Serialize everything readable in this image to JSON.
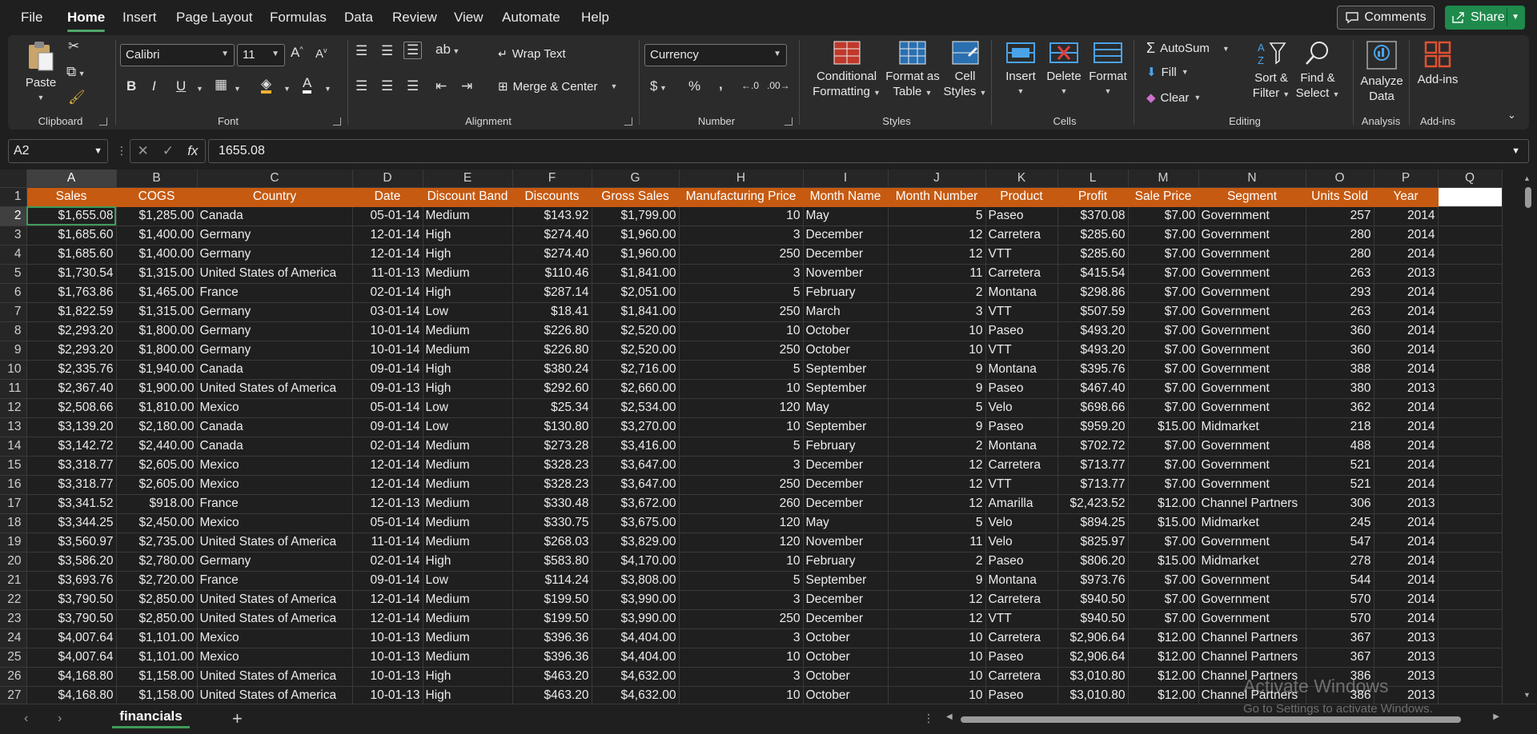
{
  "menu": {
    "items": [
      "File",
      "Home",
      "Insert",
      "Page Layout",
      "Formulas",
      "Data",
      "Review",
      "View",
      "Automate",
      "Help"
    ],
    "active": "Home",
    "comments_label": "Comments",
    "share_label": "Share"
  },
  "ribbon": {
    "clipboard": {
      "label": "Clipboard",
      "paste": "Paste"
    },
    "font": {
      "label": "Font",
      "font_name": "Calibri",
      "font_size": "11"
    },
    "alignment": {
      "label": "Alignment",
      "wrap_text": "Wrap Text",
      "merge_center": "Merge & Center"
    },
    "number": {
      "label": "Number",
      "format": "Currency"
    },
    "styles": {
      "label": "Styles",
      "conditional": [
        "Conditional",
        "Formatting"
      ],
      "format_table": [
        "Format as",
        "Table"
      ],
      "cell_styles": [
        "Cell",
        "Styles"
      ]
    },
    "cells": {
      "label": "Cells",
      "insert": "Insert",
      "delete": "Delete",
      "format": "Format"
    },
    "editing": {
      "label": "Editing",
      "autosum": "AutoSum",
      "fill": "Fill",
      "clear": "Clear",
      "sort": [
        "Sort &",
        "Filter"
      ],
      "find": [
        "Find &",
        "Select"
      ]
    },
    "analysis": {
      "label": "Analysis",
      "analyze": [
        "Analyze",
        "Data"
      ]
    },
    "addins": {
      "label": "Add-ins",
      "addins": "Add-ins"
    }
  },
  "formula_bar": {
    "cell_ref": "A2",
    "formula": "1655.08",
    "fx": "fx"
  },
  "sheet": {
    "columns": [
      "A",
      "B",
      "C",
      "D",
      "E",
      "F",
      "G",
      "H",
      "I",
      "J",
      "K",
      "L",
      "M",
      "N",
      "O",
      "P",
      "Q"
    ],
    "headers": [
      "Sales",
      "COGS",
      "Country",
      "Date",
      "Discount Band",
      "Discounts",
      "Gross Sales",
      "Manufacturing Price",
      "Month Name",
      "Month Number",
      "Product",
      "Profit",
      "Sale Price",
      "Segment",
      "Units Sold",
      "Year"
    ],
    "rows": [
      [
        "$1,655.08",
        "$1,285.00",
        "Canada",
        "05-01-14",
        "Medium",
        "$143.92",
        "$1,799.00",
        "10",
        "May",
        "5",
        "Paseo",
        "$370.08",
        "$7.00",
        "Government",
        "257",
        "2014"
      ],
      [
        "$1,685.60",
        "$1,400.00",
        "Germany",
        "12-01-14",
        "High",
        "$274.40",
        "$1,960.00",
        "3",
        "December",
        "12",
        "Carretera",
        "$285.60",
        "$7.00",
        "Government",
        "280",
        "2014"
      ],
      [
        "$1,685.60",
        "$1,400.00",
        "Germany",
        "12-01-14",
        "High",
        "$274.40",
        "$1,960.00",
        "250",
        "December",
        "12",
        "VTT",
        "$285.60",
        "$7.00",
        "Government",
        "280",
        "2014"
      ],
      [
        "$1,730.54",
        "$1,315.00",
        "United States of America",
        "11-01-13",
        "Medium",
        "$110.46",
        "$1,841.00",
        "3",
        "November",
        "11",
        "Carretera",
        "$415.54",
        "$7.00",
        "Government",
        "263",
        "2013"
      ],
      [
        "$1,763.86",
        "$1,465.00",
        "France",
        "02-01-14",
        "High",
        "$287.14",
        "$2,051.00",
        "5",
        "February",
        "2",
        "Montana",
        "$298.86",
        "$7.00",
        "Government",
        "293",
        "2014"
      ],
      [
        "$1,822.59",
        "$1,315.00",
        "Germany",
        "03-01-14",
        "Low",
        "$18.41",
        "$1,841.00",
        "250",
        "March",
        "3",
        "VTT",
        "$507.59",
        "$7.00",
        "Government",
        "263",
        "2014"
      ],
      [
        "$2,293.20",
        "$1,800.00",
        "Germany",
        "10-01-14",
        "Medium",
        "$226.80",
        "$2,520.00",
        "10",
        "October",
        "10",
        "Paseo",
        "$493.20",
        "$7.00",
        "Government",
        "360",
        "2014"
      ],
      [
        "$2,293.20",
        "$1,800.00",
        "Germany",
        "10-01-14",
        "Medium",
        "$226.80",
        "$2,520.00",
        "250",
        "October",
        "10",
        "VTT",
        "$493.20",
        "$7.00",
        "Government",
        "360",
        "2014"
      ],
      [
        "$2,335.76",
        "$1,940.00",
        "Canada",
        "09-01-14",
        "High",
        "$380.24",
        "$2,716.00",
        "5",
        "September",
        "9",
        "Montana",
        "$395.76",
        "$7.00",
        "Government",
        "388",
        "2014"
      ],
      [
        "$2,367.40",
        "$1,900.00",
        "United States of America",
        "09-01-13",
        "High",
        "$292.60",
        "$2,660.00",
        "10",
        "September",
        "9",
        "Paseo",
        "$467.40",
        "$7.00",
        "Government",
        "380",
        "2013"
      ],
      [
        "$2,508.66",
        "$1,810.00",
        "Mexico",
        "05-01-14",
        "Low",
        "$25.34",
        "$2,534.00",
        "120",
        "May",
        "5",
        "Velo",
        "$698.66",
        "$7.00",
        "Government",
        "362",
        "2014"
      ],
      [
        "$3,139.20",
        "$2,180.00",
        "Canada",
        "09-01-14",
        "Low",
        "$130.80",
        "$3,270.00",
        "10",
        "September",
        "9",
        "Paseo",
        "$959.20",
        "$15.00",
        "Midmarket",
        "218",
        "2014"
      ],
      [
        "$3,142.72",
        "$2,440.00",
        "Canada",
        "02-01-14",
        "Medium",
        "$273.28",
        "$3,416.00",
        "5",
        "February",
        "2",
        "Montana",
        "$702.72",
        "$7.00",
        "Government",
        "488",
        "2014"
      ],
      [
        "$3,318.77",
        "$2,605.00",
        "Mexico",
        "12-01-14",
        "Medium",
        "$328.23",
        "$3,647.00",
        "3",
        "December",
        "12",
        "Carretera",
        "$713.77",
        "$7.00",
        "Government",
        "521",
        "2014"
      ],
      [
        "$3,318.77",
        "$2,605.00",
        "Mexico",
        "12-01-14",
        "Medium",
        "$328.23",
        "$3,647.00",
        "250",
        "December",
        "12",
        "VTT",
        "$713.77",
        "$7.00",
        "Government",
        "521",
        "2014"
      ],
      [
        "$3,341.52",
        "$918.00",
        "France",
        "12-01-13",
        "Medium",
        "$330.48",
        "$3,672.00",
        "260",
        "December",
        "12",
        "Amarilla",
        "$2,423.52",
        "$12.00",
        "Channel Partners",
        "306",
        "2013"
      ],
      [
        "$3,344.25",
        "$2,450.00",
        "Mexico",
        "05-01-14",
        "Medium",
        "$330.75",
        "$3,675.00",
        "120",
        "May",
        "5",
        "Velo",
        "$894.25",
        "$15.00",
        "Midmarket",
        "245",
        "2014"
      ],
      [
        "$3,560.97",
        "$2,735.00",
        "United States of America",
        "11-01-14",
        "Medium",
        "$268.03",
        "$3,829.00",
        "120",
        "November",
        "11",
        "Velo",
        "$825.97",
        "$7.00",
        "Government",
        "547",
        "2014"
      ],
      [
        "$3,586.20",
        "$2,780.00",
        "Germany",
        "02-01-14",
        "High",
        "$583.80",
        "$4,170.00",
        "10",
        "February",
        "2",
        "Paseo",
        "$806.20",
        "$15.00",
        "Midmarket",
        "278",
        "2014"
      ],
      [
        "$3,693.76",
        "$2,720.00",
        "France",
        "09-01-14",
        "Low",
        "$114.24",
        "$3,808.00",
        "5",
        "September",
        "9",
        "Montana",
        "$973.76",
        "$7.00",
        "Government",
        "544",
        "2014"
      ],
      [
        "$3,790.50",
        "$2,850.00",
        "United States of America",
        "12-01-14",
        "Medium",
        "$199.50",
        "$3,990.00",
        "3",
        "December",
        "12",
        "Carretera",
        "$940.50",
        "$7.00",
        "Government",
        "570",
        "2014"
      ],
      [
        "$3,790.50",
        "$2,850.00",
        "United States of America",
        "12-01-14",
        "Medium",
        "$199.50",
        "$3,990.00",
        "250",
        "December",
        "12",
        "VTT",
        "$940.50",
        "$7.00",
        "Government",
        "570",
        "2014"
      ],
      [
        "$4,007.64",
        "$1,101.00",
        "Mexico",
        "10-01-13",
        "Medium",
        "$396.36",
        "$4,404.00",
        "3",
        "October",
        "10",
        "Carretera",
        "$2,906.64",
        "$12.00",
        "Channel Partners",
        "367",
        "2013"
      ],
      [
        "$4,007.64",
        "$1,101.00",
        "Mexico",
        "10-01-13",
        "Medium",
        "$396.36",
        "$4,404.00",
        "10",
        "October",
        "10",
        "Paseo",
        "$2,906.64",
        "$12.00",
        "Channel Partners",
        "367",
        "2013"
      ],
      [
        "$4,168.80",
        "$1,158.00",
        "United States of America",
        "10-01-13",
        "High",
        "$463.20",
        "$4,632.00",
        "3",
        "October",
        "10",
        "Carretera",
        "$3,010.80",
        "$12.00",
        "Channel Partners",
        "386",
        "2013"
      ],
      [
        "$4,168.80",
        "$1,158.00",
        "United States of America",
        "10-01-13",
        "High",
        "$463.20",
        "$4,632.00",
        "10",
        "October",
        "10",
        "Paseo",
        "$3,010.80",
        "$12.00",
        "Channel Partners",
        "386",
        "2013"
      ]
    ],
    "text_columns": [
      2,
      4,
      8,
      10,
      13
    ]
  },
  "tabs": {
    "active_sheet": "financials"
  },
  "watermark": {
    "line1": "Activate Windows",
    "line2": "Go to Settings to activate Windows."
  },
  "colors": {
    "header_fill": "#c65a11",
    "accent": "#3f9b5a",
    "share": "#1e8a4c"
  }
}
